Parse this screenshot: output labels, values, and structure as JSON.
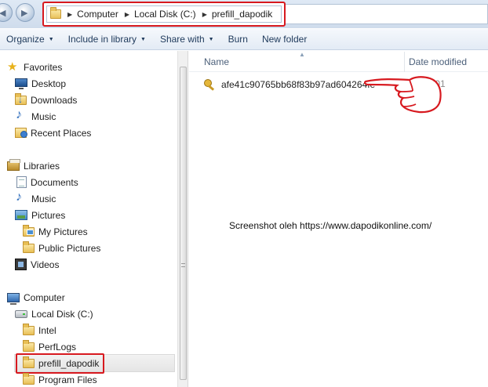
{
  "address_bar": {
    "crumbs": [
      "Computer",
      "Local Disk (C:)",
      "prefill_dapodik"
    ]
  },
  "toolbar": {
    "organize": "Organize",
    "include_in_library": "Include in library",
    "share_with": "Share with",
    "burn": "Burn",
    "new_folder": "New folder"
  },
  "nav": {
    "favorites": "Favorites",
    "desktop": "Desktop",
    "downloads": "Downloads",
    "music": "Music",
    "recent_places": "Recent Places",
    "libraries": "Libraries",
    "documents": "Documents",
    "lib_music": "Music",
    "pictures": "Pictures",
    "my_pictures": "My Pictures",
    "public_pictures": "Public Pictures",
    "videos": "Videos",
    "computer": "Computer",
    "local_disk": "Local Disk (C:)",
    "intel": "Intel",
    "perflogs": "PerfLogs",
    "prefill_dapodik": "prefill_dapodik",
    "program_files": "Program Files"
  },
  "columns": {
    "name": "Name",
    "date_modified": "Date modified"
  },
  "files": [
    {
      "name": "afe41c90765bb68f83b97ad604264fe",
      "date": "7/31/201"
    }
  ],
  "watermark": "Screenshot oleh https://www.dapodikonline.com/",
  "colors": {
    "highlight_red": "#d7191f",
    "toolbar_text": "#1e395b",
    "header_text": "#4c607a"
  },
  "icons": [
    "folder-icon",
    "key-icon",
    "star-icon",
    "pointing-hand-icon"
  ]
}
